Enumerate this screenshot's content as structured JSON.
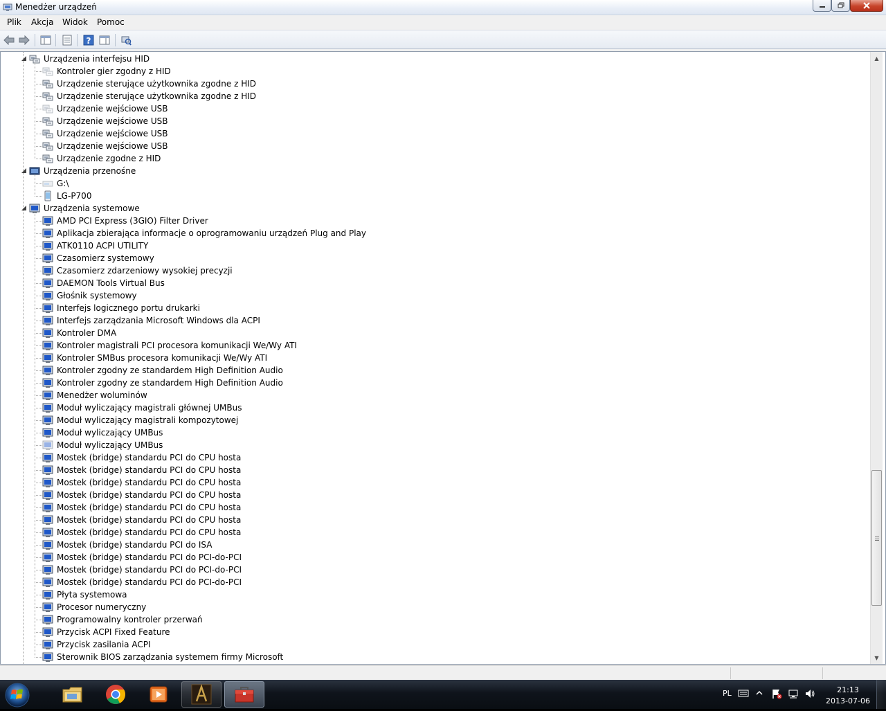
{
  "window": {
    "title": "Menedżer urządzeń"
  },
  "menu": {
    "items": [
      "Plik",
      "Akcja",
      "Widok",
      "Pomoc"
    ]
  },
  "tree": {
    "categories": [
      {
        "label": "Urządzenia interfejsu HID",
        "icon": "hid-category-icon",
        "expanded": true,
        "children": [
          {
            "label": "Kontroler gier zgodny z HID",
            "icon": "hid-device-icon",
            "disabled": true
          },
          {
            "label": "Urządzenie sterujące użytkownika zgodne z HID",
            "icon": "hid-device-icon"
          },
          {
            "label": "Urządzenie sterujące użytkownika zgodne z HID",
            "icon": "hid-device-icon"
          },
          {
            "label": "Urządzenie wejściowe USB",
            "icon": "hid-device-icon",
            "disabled": true
          },
          {
            "label": "Urządzenie wejściowe USB",
            "icon": "hid-device-icon"
          },
          {
            "label": "Urządzenie wejściowe USB",
            "icon": "hid-device-icon"
          },
          {
            "label": "Urządzenie wejściowe USB",
            "icon": "hid-device-icon"
          },
          {
            "label": "Urządzenie zgodne z HID",
            "icon": "hid-device-icon"
          }
        ]
      },
      {
        "label": "Urządzenia przenośne",
        "icon": "portable-category-icon",
        "expanded": true,
        "children": [
          {
            "label": "G:\\",
            "icon": "drive-icon",
            "disabled": true
          },
          {
            "label": "LG-P700",
            "icon": "phone-icon"
          }
        ]
      },
      {
        "label": "Urządzenia systemowe",
        "icon": "system-category-icon",
        "expanded": true,
        "children": [
          {
            "label": "AMD PCI Express (3GIO) Filter Driver",
            "icon": "system-device-icon"
          },
          {
            "label": "Aplikacja zbierająca informacje o oprogramowaniu urządzeń Plug and Play",
            "icon": "system-device-icon"
          },
          {
            "label": "ATK0110 ACPI UTILITY",
            "icon": "system-device-icon"
          },
          {
            "label": "Czasomierz systemowy",
            "icon": "system-device-icon"
          },
          {
            "label": "Czasomierz zdarzeniowy wysokiej precyzji",
            "icon": "system-device-icon"
          },
          {
            "label": "DAEMON Tools Virtual Bus",
            "icon": "system-device-icon"
          },
          {
            "label": "Głośnik systemowy",
            "icon": "system-device-icon"
          },
          {
            "label": "Interfejs logicznego portu drukarki",
            "icon": "system-device-icon"
          },
          {
            "label": "Interfejs zarządzania Microsoft Windows dla ACPI",
            "icon": "system-device-icon"
          },
          {
            "label": "Kontroler DMA",
            "icon": "system-device-icon"
          },
          {
            "label": "Kontroler magistrali PCI procesora komunikacji We/Wy ATI",
            "icon": "system-device-icon"
          },
          {
            "label": "Kontroler SMBus procesora komunikacji We/Wy ATI",
            "icon": "system-device-icon"
          },
          {
            "label": "Kontroler zgodny ze standardem High Definition Audio",
            "icon": "system-device-icon"
          },
          {
            "label": "Kontroler zgodny ze standardem High Definition Audio",
            "icon": "system-device-icon"
          },
          {
            "label": "Menedżer woluminów",
            "icon": "system-device-icon"
          },
          {
            "label": "Moduł wyliczający magistrali głównej UMBus",
            "icon": "system-device-icon"
          },
          {
            "label": "Moduł wyliczający magistrali kompozytowej",
            "icon": "system-device-icon"
          },
          {
            "label": "Moduł wyliczający UMBus",
            "icon": "system-device-icon"
          },
          {
            "label": "Moduł wyliczający UMBus",
            "icon": "system-device-icon",
            "disabled": true
          },
          {
            "label": "Mostek (bridge) standardu PCI do CPU hosta",
            "icon": "system-device-icon"
          },
          {
            "label": "Mostek (bridge) standardu PCI do CPU hosta",
            "icon": "system-device-icon"
          },
          {
            "label": "Mostek (bridge) standardu PCI do CPU hosta",
            "icon": "system-device-icon"
          },
          {
            "label": "Mostek (bridge) standardu PCI do CPU hosta",
            "icon": "system-device-icon"
          },
          {
            "label": "Mostek (bridge) standardu PCI do CPU hosta",
            "icon": "system-device-icon"
          },
          {
            "label": "Mostek (bridge) standardu PCI do CPU hosta",
            "icon": "system-device-icon"
          },
          {
            "label": "Mostek (bridge) standardu PCI do CPU hosta",
            "icon": "system-device-icon"
          },
          {
            "label": "Mostek (bridge) standardu PCI do ISA",
            "icon": "system-device-icon"
          },
          {
            "label": "Mostek (bridge) standardu PCI do PCI-do-PCI",
            "icon": "system-device-icon"
          },
          {
            "label": "Mostek (bridge) standardu PCI do PCI-do-PCI",
            "icon": "system-device-icon"
          },
          {
            "label": "Mostek (bridge) standardu PCI do PCI-do-PCI",
            "icon": "system-device-icon"
          },
          {
            "label": "Płyta systemowa",
            "icon": "system-device-icon"
          },
          {
            "label": "Procesor numeryczny",
            "icon": "system-device-icon"
          },
          {
            "label": "Programowalny kontroler przerwań",
            "icon": "system-device-icon"
          },
          {
            "label": "Przycisk ACPI Fixed Feature",
            "icon": "system-device-icon"
          },
          {
            "label": "Przycisk zasilania ACPI",
            "icon": "system-device-icon"
          },
          {
            "label": "Sterownik BIOS zarządzania systemem firmy Microsoft",
            "icon": "system-device-icon"
          }
        ]
      }
    ]
  },
  "scrollbar": {
    "position_fraction": 0.69,
    "visible_fraction": 0.23
  },
  "taskbar": {
    "apps": [
      {
        "name": "explorer",
        "icon": "folder-icon",
        "state": ""
      },
      {
        "name": "chrome",
        "icon": "chrome-icon",
        "state": ""
      },
      {
        "name": "media-player",
        "icon": "media-player-icon",
        "state": ""
      },
      {
        "name": "game",
        "icon": "game-a-icon",
        "state": "open"
      },
      {
        "name": "device-manager",
        "icon": "toolbox-icon",
        "state": "active"
      }
    ],
    "tray": {
      "language": "PL"
    },
    "clock": {
      "time": "21:13",
      "date": "2013-07-06"
    }
  }
}
